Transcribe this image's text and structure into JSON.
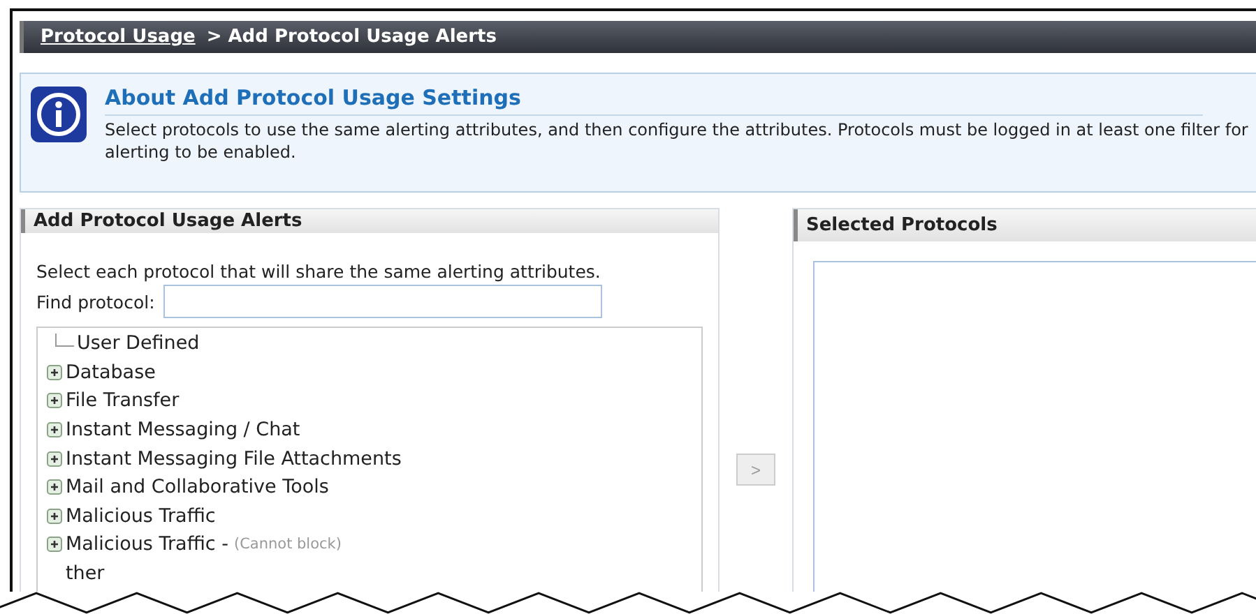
{
  "breadcrumb": {
    "link": "Protocol Usage",
    "current": "> Add Protocol Usage Alerts"
  },
  "info": {
    "title": "About Add Protocol Usage Settings",
    "text": "Select protocols to use the same alerting attributes, and then configure the attributes. Protocols must be logged in at least one filter for alerting to be enabled."
  },
  "left_panel": {
    "title": "Add Protocol Usage Alerts",
    "instruction": "Select each protocol that will share the same alerting attributes.",
    "find_label": "Find protocol:",
    "tree": [
      {
        "kind": "leaf",
        "label": "User Defined"
      },
      {
        "kind": "group",
        "label": "Database",
        "expanded": false
      },
      {
        "kind": "group",
        "label": "File Transfer",
        "expanded": false
      },
      {
        "kind": "group",
        "label": "Instant Messaging / Chat",
        "expanded": false
      },
      {
        "kind": "group",
        "label": "Instant Messaging File Attachments",
        "expanded": false
      },
      {
        "kind": "group",
        "label": "Mail and Collaborative Tools",
        "expanded": false
      },
      {
        "kind": "group",
        "label": "Malicious Traffic",
        "expanded": false
      },
      {
        "kind": "group",
        "label": "Malicious Traffic -",
        "note": "(Cannot block)",
        "expanded": false
      },
      {
        "kind": "partial",
        "label": "ther"
      }
    ]
  },
  "move_button": {
    "label": ">",
    "disabled": true
  },
  "right_panel": {
    "title": "Selected Protocols"
  }
}
